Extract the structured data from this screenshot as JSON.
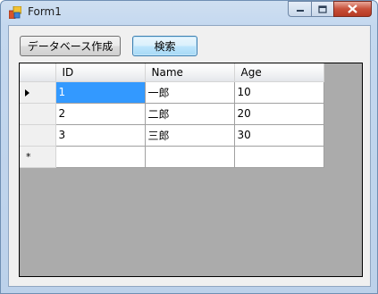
{
  "window": {
    "title": "Form1"
  },
  "toolbar": {
    "create_db_label": "データベース作成",
    "search_label": "検索"
  },
  "grid": {
    "columns": [
      "ID",
      "Name",
      "Age"
    ],
    "rows": [
      [
        "1",
        "一郎",
        "10"
      ],
      [
        "2",
        "二郎",
        "20"
      ],
      [
        "3",
        "三郎",
        "30"
      ]
    ],
    "new_row_marker": "*"
  },
  "icons": {
    "app": "form-app-icon",
    "minimize": "minimize-icon",
    "maximize": "maximize-icon",
    "close": "close-icon",
    "current_row": "current-row-arrow-icon"
  },
  "colors": {
    "selection": "#3399ff",
    "grid_background": "#ababab"
  }
}
